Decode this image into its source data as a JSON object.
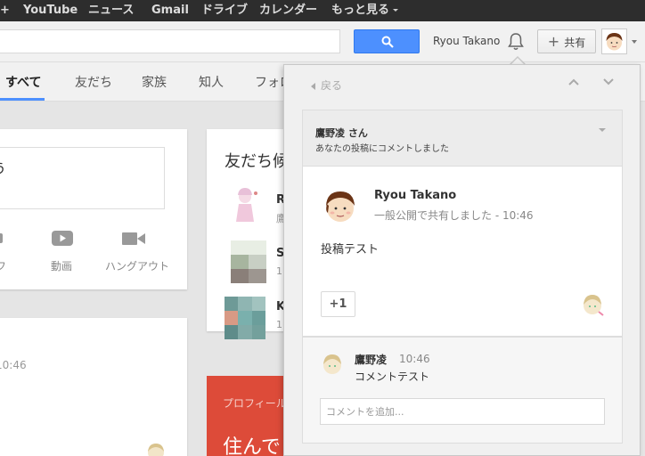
{
  "topnav": {
    "items": [
      "YouTube",
      "ニュース",
      "Gmail",
      "ドライブ",
      "カレンダー",
      "もっと見る"
    ]
  },
  "header": {
    "user_name": "Ryou Takano",
    "share_label": "共有",
    "search_placeholder": ""
  },
  "tabs": [
    "すべて",
    "友だち",
    "家族",
    "知人",
    "フォロ"
  ],
  "left": {
    "share_text": "う",
    "media": [
      {
        "label": "フ",
        "icon": "camera-icon"
      },
      {
        "label": "動画",
        "icon": "youtube-icon"
      },
      {
        "label": "ハングアウト",
        "icon": "hangout-icon"
      }
    ],
    "time_fragment": "10:46",
    "red_card_text": "プロフィール",
    "red_card_big": "住んで"
  },
  "friends": {
    "title": "友だち候",
    "items": [
      {
        "letter": "R",
        "sub": "鷹"
      },
      {
        "letter": "S",
        "sub": "1"
      },
      {
        "letter": "K",
        "sub": "1"
      }
    ]
  },
  "panel": {
    "back_label": "戻る",
    "notification": {
      "name": "鷹野凌 さん",
      "description": "あなたの投稿にコメントしました"
    },
    "post": {
      "author": "Ryou Takano",
      "meta": "一般公開で共有しました  -  10:46",
      "text": "投稿テスト",
      "plusone_label": "+1"
    },
    "comment": {
      "author": "鷹野凌",
      "time": "10:46",
      "text": "コメントテスト",
      "placeholder": "コメントを追加..."
    }
  },
  "colors": {
    "accent_blue": "#4d90fe",
    "topbar": "#2d2d2d",
    "red": "#dd4b39"
  }
}
